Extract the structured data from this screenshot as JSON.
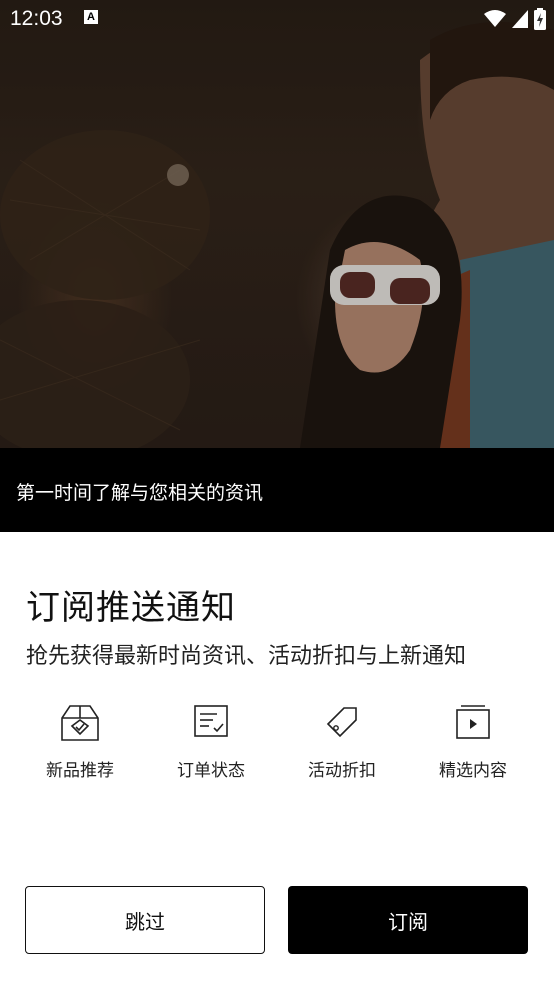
{
  "status_bar": {
    "time": "12:03",
    "notification_icon": "A"
  },
  "hero": {
    "caption": "第一时间了解与您相关的资讯"
  },
  "dialog": {
    "title": "订阅推送通知",
    "subtitle": "抢先获得最新时尚资讯、活动折扣与上新通知",
    "features": [
      {
        "label": "新品推荐",
        "icon": "box-icon"
      },
      {
        "label": "订单状态",
        "icon": "order-check-icon"
      },
      {
        "label": "活动折扣",
        "icon": "tag-icon"
      },
      {
        "label": "精选内容",
        "icon": "video-icon"
      }
    ],
    "skip_label": "跳过",
    "subscribe_label": "订阅"
  },
  "colors": {
    "caption_bg": "#000000",
    "primary_button": "#000000",
    "text": "#111111"
  }
}
